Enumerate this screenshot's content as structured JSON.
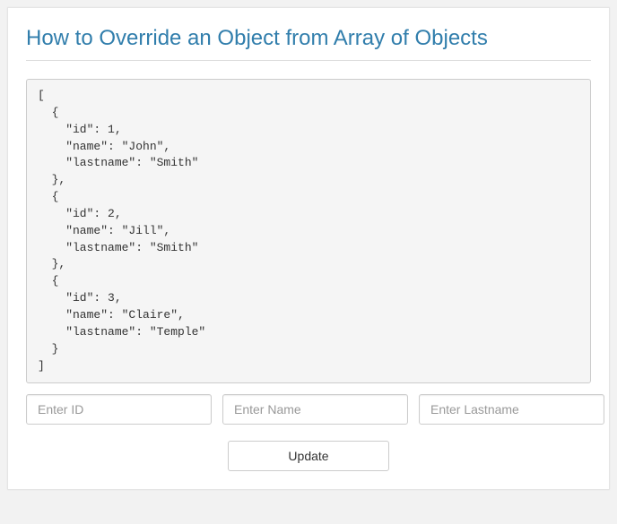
{
  "title": "How to Override an Object from Array of Objects",
  "code_text": "[\n  {\n    \"id\": 1,\n    \"name\": \"John\",\n    \"lastname\": \"Smith\"\n  },\n  {\n    \"id\": 2,\n    \"name\": \"Jill\",\n    \"lastname\": \"Smith\"\n  },\n  {\n    \"id\": 3,\n    \"name\": \"Claire\",\n    \"lastname\": \"Temple\"\n  }\n]",
  "inputs": {
    "id_placeholder": "Enter ID",
    "name_placeholder": "Enter Name",
    "lastname_placeholder": "Enter Lastname"
  },
  "button": {
    "update_label": "Update"
  }
}
